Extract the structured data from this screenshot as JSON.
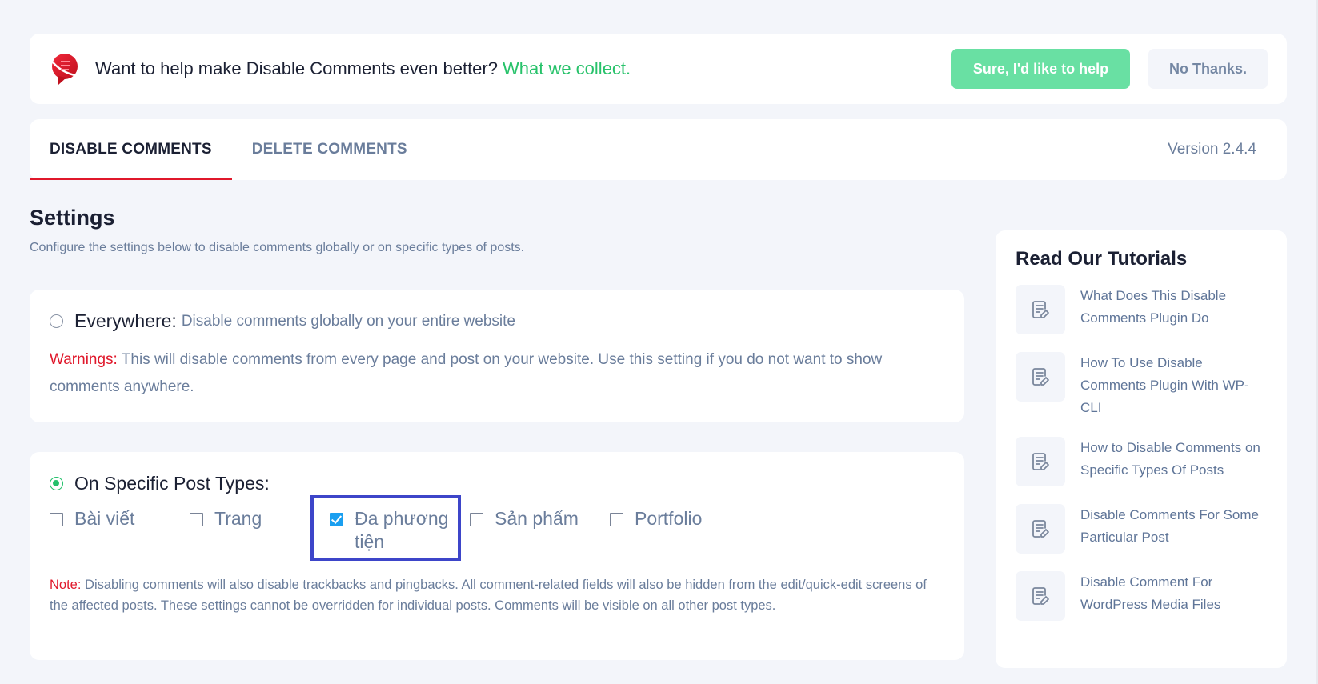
{
  "banner": {
    "message": "Want to help make Disable Comments even better?",
    "link_label": "What we collect.",
    "accept_label": "Sure, I'd like to help",
    "decline_label": "No Thanks.",
    "logo_icon": "disable-comments-logo"
  },
  "tabs": [
    {
      "label": "DISABLE COMMENTS",
      "active": true
    },
    {
      "label": "DELETE COMMENTS",
      "active": false
    }
  ],
  "version": "Version 2.4.4",
  "settings": {
    "title": "Settings",
    "description": "Configure the settings below to disable comments globally or on specific types of posts."
  },
  "everywhere": {
    "label": "Everywhere:",
    "description": "Disable comments globally on your entire website",
    "selected": false,
    "warning_label": "Warnings:",
    "warning_text": "This will disable comments from every page and post on your website. Use this setting if you do not want to show comments anywhere."
  },
  "specific": {
    "label": "On Specific Post Types:",
    "selected": true,
    "post_types": [
      {
        "label": "Bài viết",
        "checked": false
      },
      {
        "label": "Trang",
        "checked": false
      },
      {
        "label": "Đa phương tiện",
        "checked": true
      },
      {
        "label": "Sản phẩm",
        "checked": false
      },
      {
        "label": "Portfolio",
        "checked": false
      }
    ],
    "note_label": "Note:",
    "note_text": "Disabling comments will also disable trackbacks and pingbacks. All comment-related fields will also be hidden from the edit/quick-edit screens of the affected posts. These settings cannot be overridden for individual posts. Comments will be visible on all other post types."
  },
  "tutorials": {
    "title": "Read Our Tutorials",
    "items": [
      {
        "label": "What Does This Disable Comments Plugin Do",
        "icon": "document-edit-icon"
      },
      {
        "label": "How To Use Disable Comments Plugin With WP-CLI",
        "icon": "document-edit-icon"
      },
      {
        "label": "How to Disable Comments on Specific Types Of Posts",
        "icon": "document-edit-icon"
      },
      {
        "label": "Disable Comments For Some Particular Post",
        "icon": "document-edit-icon"
      },
      {
        "label": "Disable Comment For WordPress Media Files",
        "icon": "document-edit-icon"
      }
    ]
  },
  "colors": {
    "accent_green": "#69e0a3",
    "link_green": "#27c26a",
    "warning_red": "#e0182b",
    "checkbox_blue": "#1a9ff0",
    "highlight_border": "#3d45c9"
  }
}
